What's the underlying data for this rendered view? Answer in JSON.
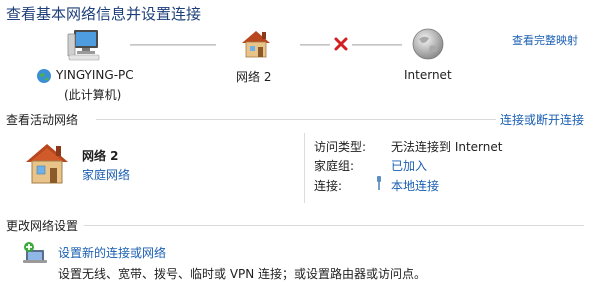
{
  "header": {
    "title": "查看基本网络信息并设置连接",
    "full_map_link": "查看完整映射"
  },
  "map": {
    "computer": {
      "name": "YINGYING-PC",
      "sub": "(此计算机)"
    },
    "network": {
      "name": "网络  2"
    },
    "internet": {
      "name": "Internet"
    },
    "connection_status": "broken"
  },
  "active": {
    "section_title": "查看活动网络",
    "connect_link": "连接或断开连接",
    "network_name": "网络  2",
    "network_type": "家庭网络",
    "access_type_label": "访问类型:",
    "access_type_value": "无法连接到 Internet",
    "homegroup_label": "家庭组:",
    "homegroup_value": "已加入",
    "connection_label": "连接:",
    "connection_value": "本地连接"
  },
  "change": {
    "section_title": "更改网络设置",
    "setup_link": "设置新的连接或网络",
    "setup_desc": "设置无线、宽带、拨号、临时或 VPN 连接；或设置路由器或访问点。"
  },
  "colors": {
    "link": "#1a5fb4",
    "title": "#1e3f7a",
    "error_x": "#d21f1f"
  },
  "icons": [
    "computer-icon",
    "network-globe-icon",
    "house-icon",
    "error-x-icon",
    "globe-icon",
    "cable-icon",
    "setup-network-icon"
  ]
}
